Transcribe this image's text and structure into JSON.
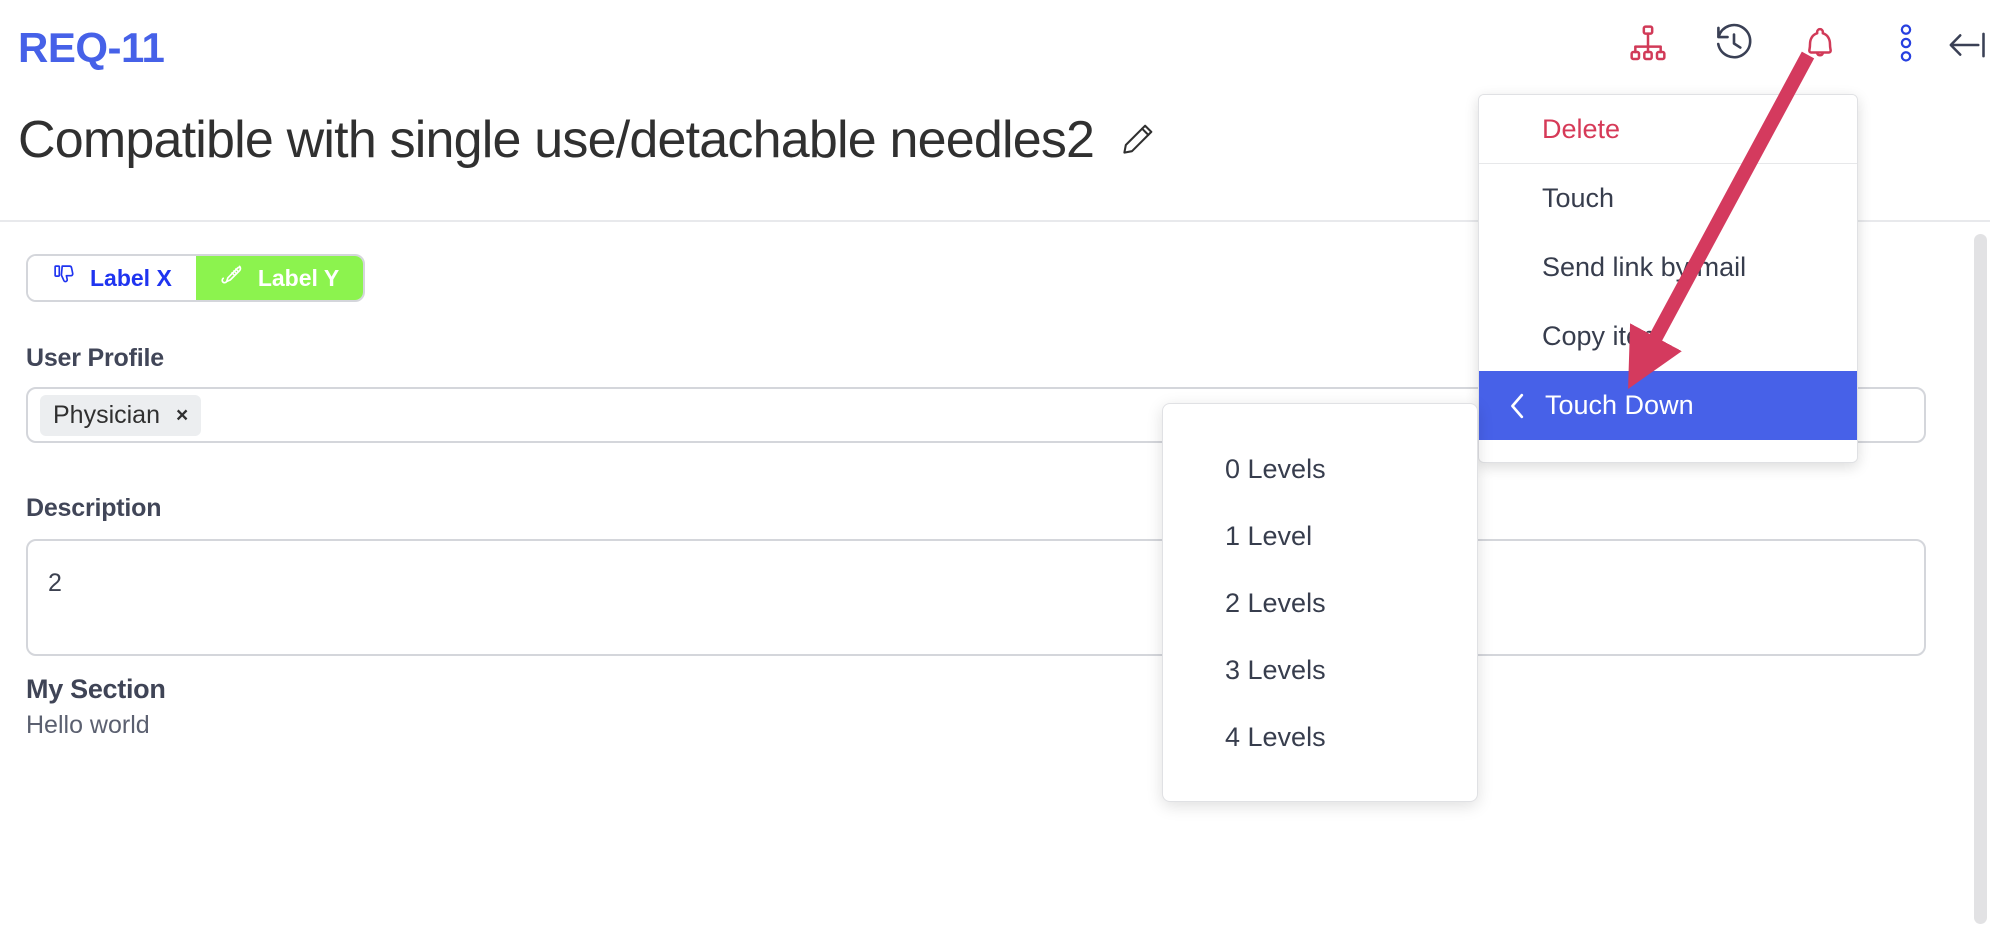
{
  "header": {
    "req_id": "REQ-11",
    "title": "Compatible with single use/detachable needles2",
    "edit_icon": "pencil-icon",
    "icons": [
      {
        "name": "hierarchy-icon",
        "color": "#d13a58"
      },
      {
        "name": "history-icon",
        "color": "#3a4055"
      },
      {
        "name": "bell-icon",
        "color": "#d13a58"
      },
      {
        "name": "more-vertical-icon",
        "color": "#2740e0"
      }
    ],
    "collapse_icon": "collapse-left-icon"
  },
  "labels": {
    "items": [
      {
        "text": "Label X",
        "icon": "thumbs-down-icon",
        "color": "#1f34f0",
        "background": "#ffffff"
      },
      {
        "text": "Label Y",
        "icon": "thermometer-icon",
        "color": "#ffffff",
        "background": "#8cf34e"
      }
    ]
  },
  "fields": {
    "user_profile": {
      "label": "User Profile",
      "tags": [
        {
          "text": "Physician",
          "remove": "×"
        }
      ]
    },
    "description": {
      "label": "Description",
      "value": "2"
    },
    "my_section": {
      "title": "My Section",
      "text": "Hello world"
    }
  },
  "menu": {
    "items": [
      {
        "label": "Delete",
        "style": "danger"
      },
      {
        "label": "Touch",
        "style": "normal"
      },
      {
        "label": "Send link by mail",
        "style": "normal"
      },
      {
        "label": "Copy item",
        "style": "normal"
      },
      {
        "label": "Touch Down",
        "style": "active",
        "icon": "chevron-left-icon"
      }
    ]
  },
  "submenu": {
    "items": [
      {
        "label": "0 Levels"
      },
      {
        "label": "1 Level"
      },
      {
        "label": "2 Levels"
      },
      {
        "label": "3 Levels"
      },
      {
        "label": "4 Levels"
      }
    ]
  },
  "annotation": {
    "arrow_color": "#d43a5e",
    "points_to": "Copy item"
  },
  "colors": {
    "accent_blue": "#4661e8",
    "danger_red": "#d13a58",
    "green": "#8cf34e",
    "menu_highlight": "#4761e8"
  }
}
